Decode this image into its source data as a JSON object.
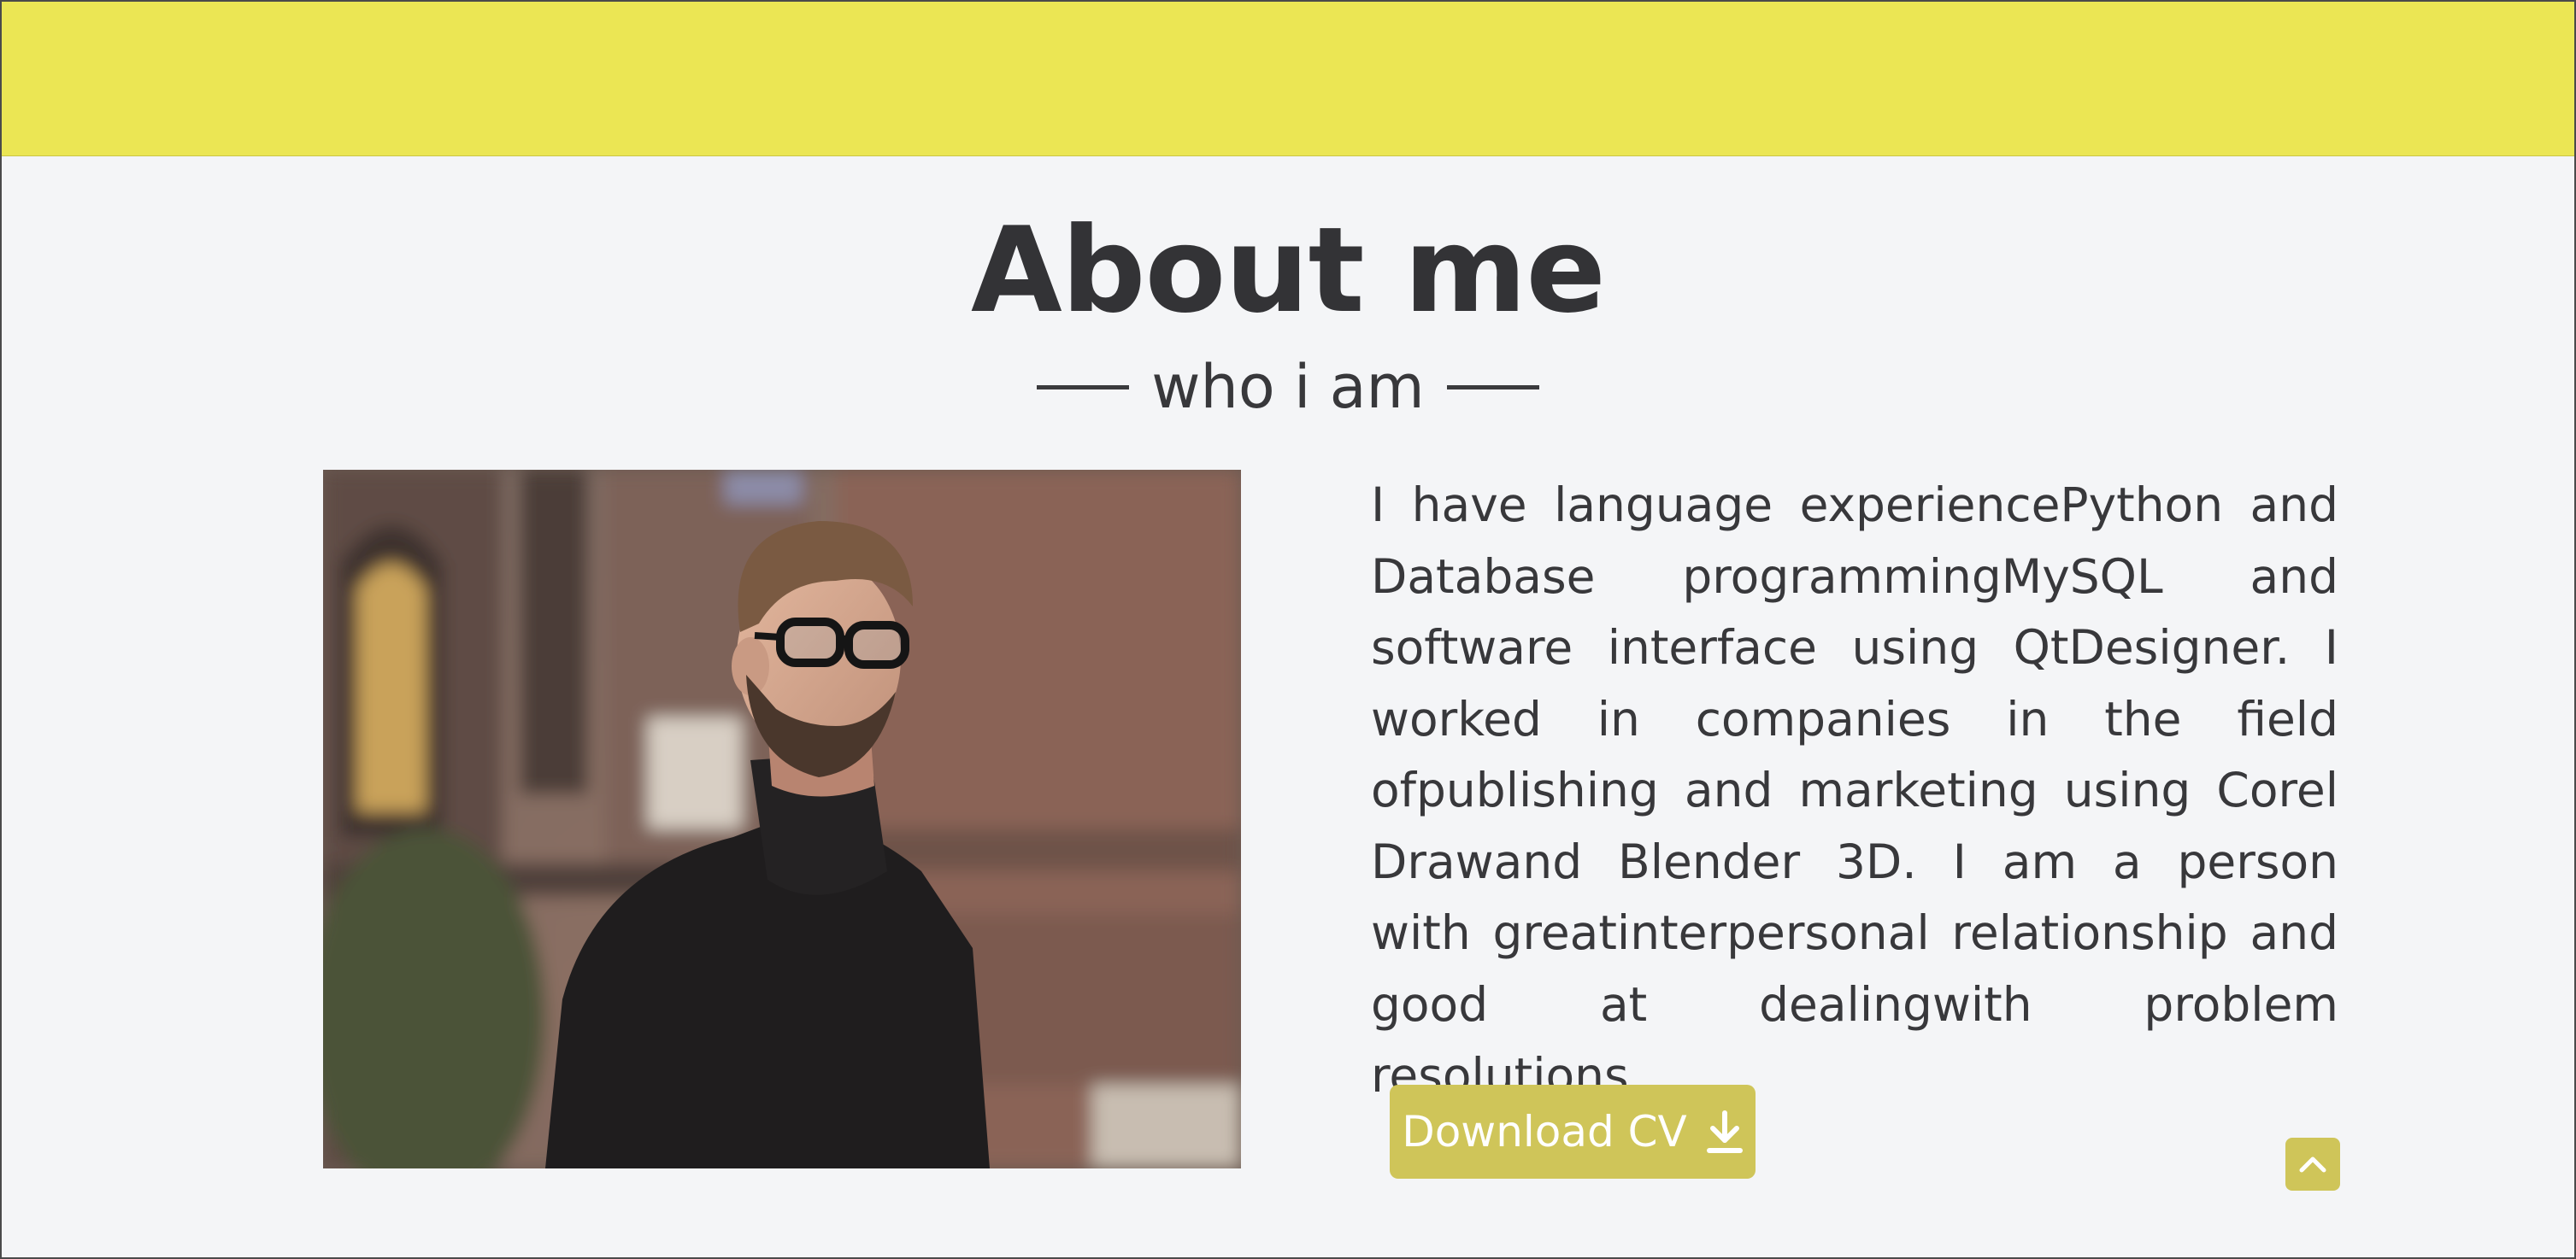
{
  "header": {
    "bar_color": "#ebe654"
  },
  "about": {
    "title": "About me",
    "subtitle": "who i am",
    "photo_alt": "Man with glasses in black turtleneck",
    "description": "I have language experiencePython and Database programmingMySQL and software interface using QtDesigner. I worked in companies in the field ofpublishing and marketing using Corel Drawand Blender 3D. I am a person with greatinterpersonal relationship and good at dealingwith problem resolutions.",
    "download_button": {
      "label": "Download CV",
      "icon": "download-icon"
    },
    "scroll_top": {
      "icon": "chevron-up-icon"
    }
  },
  "colors": {
    "accent": "#cfc559",
    "header": "#ebe654",
    "background": "#f4f5f7",
    "text": "#333336"
  }
}
